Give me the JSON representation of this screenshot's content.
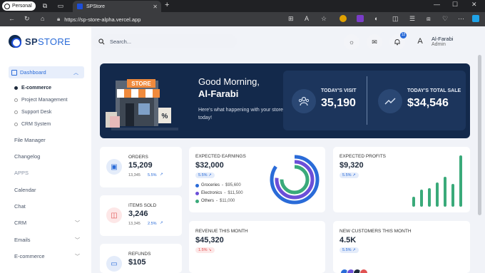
{
  "browser": {
    "profile": "Personal",
    "tab_title": "SPStore",
    "url": "https://sp-store-alpha.vercel.app"
  },
  "brand": {
    "name_bold": "SP",
    "name_rest": "STORE"
  },
  "sidebar": {
    "dashboard": "Dashboard",
    "sub_items": [
      "E-commerce",
      "Project Management",
      "Support Desk",
      "CRM System"
    ],
    "nav_items": [
      "File Manager",
      "Changelog",
      "APPS",
      "Calendar",
      "Chat",
      "CRM",
      "Emails",
      "E-commerce"
    ]
  },
  "topbar": {
    "search_placeholder": "Search...",
    "notifications_count": "12",
    "avatar_letter": "A",
    "user_name": "Al-Farabi",
    "user_role": "Admin"
  },
  "hero": {
    "greeting": "Good Morning,",
    "name": "Al-Farabi",
    "subtitle": "Here's what happening with your store today!",
    "store_sign": "STORE",
    "tag": "%",
    "visit_label": "TODAY'S VISIT",
    "visit_value": "35,190",
    "sale_label": "TODAY'S TOTAL SALE",
    "sale_value": "$34,546"
  },
  "cards": {
    "orders": {
      "title": "ORDERS",
      "value": "15,209",
      "sub": "13,345",
      "pct": "5.5%"
    },
    "items_sold": {
      "title": "ITEMS SOLD",
      "value": "3,246",
      "sub": "13,345",
      "pct": "2.5%"
    },
    "refunds": {
      "title": "REFUNDS",
      "value": "$105"
    },
    "earnings": {
      "title": "EXPECTED EARNINGS",
      "value": "$32,000",
      "chip": "5.5%",
      "legend": [
        {
          "label": "Groceries",
          "amount": "$95,600",
          "color": "#2a6bd8"
        },
        {
          "label": "Electronics",
          "amount": "$11,500",
          "color": "#6b4fd8"
        },
        {
          "label": "Others",
          "amount": "$11,000",
          "color": "#3aaa7a"
        }
      ]
    },
    "profits": {
      "title": "EXPECTED PROFITS",
      "value": "$9,320",
      "chip": "5.5%"
    },
    "revenue": {
      "title": "REVENUE THIS MONTH",
      "value": "$45,320",
      "chip": "1.5%"
    },
    "customers": {
      "title": "NEW CUSTOMERS THIS MONTH",
      "value": "4.5K",
      "chip": "5.5%"
    }
  }
}
